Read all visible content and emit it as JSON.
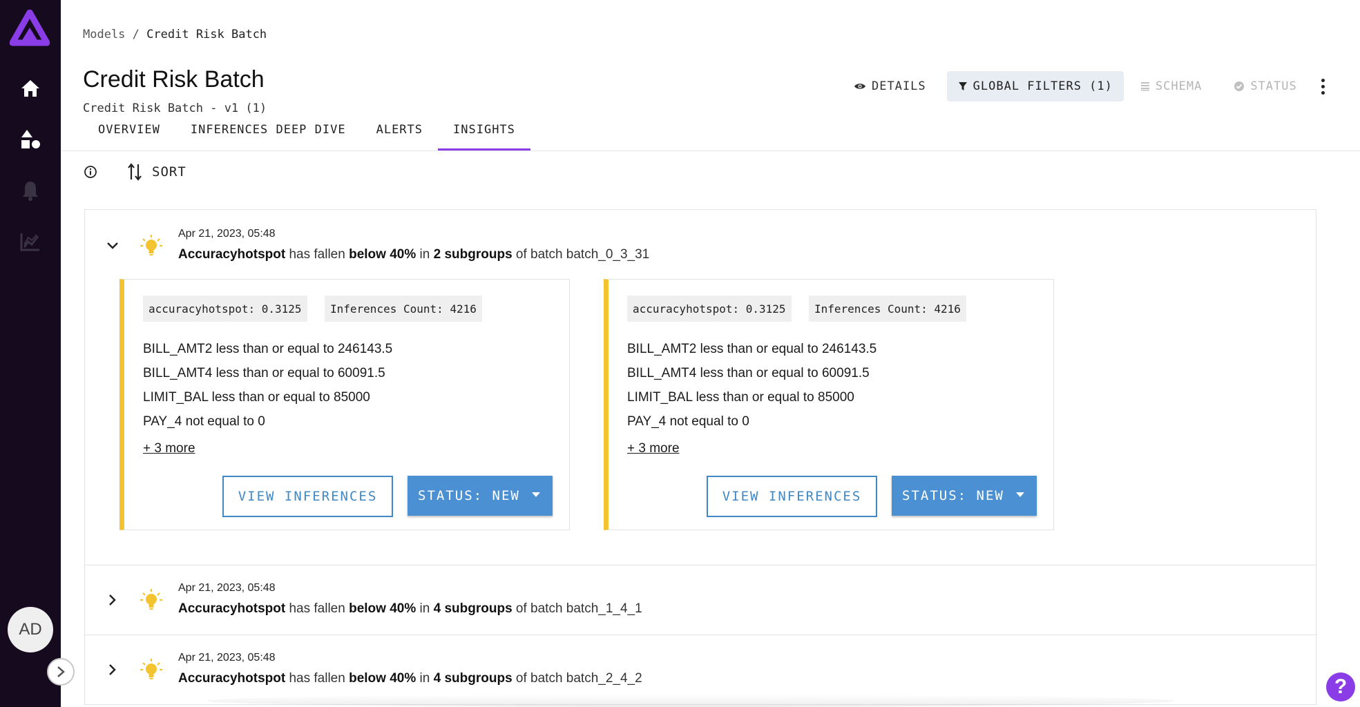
{
  "sidebar": {
    "icons": [
      "logo-icon",
      "home-icon",
      "shapes-icon",
      "bell-icon",
      "chart-icon"
    ],
    "avatar_initials": "AD",
    "accent": "#8a3de6",
    "background": "#150a1e"
  },
  "breadcrumb": {
    "parent": "Models",
    "separator": "/",
    "current": "Credit Risk Batch"
  },
  "header": {
    "title": "Credit Risk Batch",
    "subtitle": "Credit Risk Batch - v1 (1)",
    "actions": {
      "details": "DETAILS",
      "global_filters": "GLOBAL FILTERS (1)",
      "schema": "SCHEMA",
      "status": "STATUS"
    }
  },
  "tabs": [
    {
      "label": "OVERVIEW",
      "active": false
    },
    {
      "label": "INFERENCES DEEP DIVE",
      "active": false
    },
    {
      "label": "ALERTS",
      "active": false
    },
    {
      "label": "INSIGHTS",
      "active": true
    }
  ],
  "toolbar": {
    "sort_label": "SORT"
  },
  "insights": [
    {
      "expanded": true,
      "date": "Apr 21, 2023, 05:48",
      "metric": "Accuracyhotspot",
      "text1": " has fallen ",
      "threshold": "below 40%",
      "text2": " in ",
      "subgroups": "2 subgroups",
      "text3": " of batch batch_0_3_31",
      "cards": [
        {
          "chip_metric": "accuracyhotspot: 0.3125",
          "chip_count": "Inferences Count: 4216",
          "conditions": [
            "BILL_AMT2 less than or equal to 246143.5",
            "BILL_AMT4 less than or equal to 60091.5",
            "LIMIT_BAL less than or equal to 85000",
            "PAY_4 not equal to 0"
          ],
          "more": "+ 3 more",
          "view_label": "VIEW INFERENCES",
          "status_label": "STATUS: NEW"
        },
        {
          "chip_metric": "accuracyhotspot: 0.3125",
          "chip_count": "Inferences Count: 4216",
          "conditions": [
            "BILL_AMT2 less than or equal to 246143.5",
            "BILL_AMT4 less than or equal to 60091.5",
            "LIMIT_BAL less than or equal to 85000",
            "PAY_4 not equal to 0"
          ],
          "more": "+ 3 more",
          "view_label": "VIEW INFERENCES",
          "status_label": "STATUS: NEW"
        }
      ]
    },
    {
      "expanded": false,
      "date": "Apr 21, 2023, 05:48",
      "metric": "Accuracyhotspot",
      "text1": " has fallen ",
      "threshold": "below 40%",
      "text2": " in ",
      "subgroups": "4 subgroups",
      "text3": " of batch batch_1_4_1"
    },
    {
      "expanded": false,
      "date": "Apr 21, 2023, 05:48",
      "metric": "Accuracyhotspot",
      "text1": " has fallen ",
      "threshold": "below 40%",
      "text2": " in ",
      "subgroups": "4 subgroups",
      "text3": " of batch batch_2_4_2"
    }
  ],
  "help_label": "?"
}
